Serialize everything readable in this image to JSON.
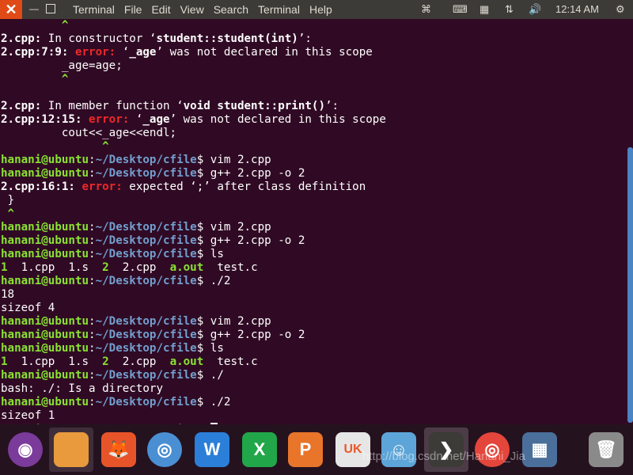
{
  "topbar": {
    "close": "✕",
    "menu": [
      "Terminal",
      "File",
      "Edit",
      "View",
      "Search",
      "Terminal",
      "Help"
    ],
    "clock": "12:14 AM"
  },
  "terminal": {
    "lines": [
      [
        {
          "t": "         ^",
          "c": "g"
        }
      ],
      [
        {
          "t": "2.cpp:",
          "c": "b"
        },
        {
          "t": " In constructor ‘"
        },
        {
          "t": "student::student(int)",
          "c": "b"
        },
        {
          "t": "’:"
        }
      ],
      [
        {
          "t": "2.cpp:7:9:",
          "c": "b"
        },
        {
          "t": " "
        },
        {
          "t": "error:",
          "c": "r"
        },
        {
          "t": " ‘"
        },
        {
          "t": "_age",
          "c": "b"
        },
        {
          "t": "’ was not declared in this scope"
        }
      ],
      [
        {
          "t": "         _age=age;"
        }
      ],
      [
        {
          "t": "         ^",
          "c": "g"
        }
      ],
      [
        {
          "t": ""
        }
      ],
      [
        {
          "t": "2.cpp:",
          "c": "b"
        },
        {
          "t": " In member function ‘"
        },
        {
          "t": "void student::print()",
          "c": "b"
        },
        {
          "t": "’:"
        }
      ],
      [
        {
          "t": "2.cpp:12:15:",
          "c": "b"
        },
        {
          "t": " "
        },
        {
          "t": "error:",
          "c": "r"
        },
        {
          "t": " ‘"
        },
        {
          "t": "_age",
          "c": "b"
        },
        {
          "t": "’ was not declared in this scope"
        }
      ],
      [
        {
          "t": "         cout<<_age<<endl;"
        }
      ],
      [
        {
          "t": "               ^",
          "c": "g"
        }
      ],
      [
        {
          "t": "hanani@ubuntu",
          "c": "g"
        },
        {
          "t": ":"
        },
        {
          "t": "~/Desktop/cfile",
          "c": "bl"
        },
        {
          "t": "$ vim 2.cpp"
        }
      ],
      [
        {
          "t": "hanani@ubuntu",
          "c": "g"
        },
        {
          "t": ":"
        },
        {
          "t": "~/Desktop/cfile",
          "c": "bl"
        },
        {
          "t": "$ g++ 2.cpp -o 2"
        }
      ],
      [
        {
          "t": "2.cpp:16:1:",
          "c": "b"
        },
        {
          "t": " "
        },
        {
          "t": "error:",
          "c": "r"
        },
        {
          "t": " expected ‘;’ after class definition"
        }
      ],
      [
        {
          "t": " }"
        }
      ],
      [
        {
          "t": " ^",
          "c": "g"
        }
      ],
      [
        {
          "t": "hanani@ubuntu",
          "c": "g"
        },
        {
          "t": ":"
        },
        {
          "t": "~/Desktop/cfile",
          "c": "bl"
        },
        {
          "t": "$ vim 2.cpp"
        }
      ],
      [
        {
          "t": "hanani@ubuntu",
          "c": "g"
        },
        {
          "t": ":"
        },
        {
          "t": "~/Desktop/cfile",
          "c": "bl"
        },
        {
          "t": "$ g++ 2.cpp -o 2"
        }
      ],
      [
        {
          "t": "hanani@ubuntu",
          "c": "g"
        },
        {
          "t": ":"
        },
        {
          "t": "~/Desktop/cfile",
          "c": "bl"
        },
        {
          "t": "$ ls"
        }
      ],
      [
        {
          "t": "1",
          "c": "g"
        },
        {
          "t": "  1.cpp  1.s  "
        },
        {
          "t": "2",
          "c": "g"
        },
        {
          "t": "  2.cpp  "
        },
        {
          "t": "a.out",
          "c": "g"
        },
        {
          "t": "  test.c"
        }
      ],
      [
        {
          "t": "hanani@ubuntu",
          "c": "g"
        },
        {
          "t": ":"
        },
        {
          "t": "~/Desktop/cfile",
          "c": "bl"
        },
        {
          "t": "$ ./2"
        }
      ],
      [
        {
          "t": "18"
        }
      ],
      [
        {
          "t": "sizeof 4"
        }
      ],
      [
        {
          "t": "hanani@ubuntu",
          "c": "g"
        },
        {
          "t": ":"
        },
        {
          "t": "~/Desktop/cfile",
          "c": "bl"
        },
        {
          "t": "$ vim 2.cpp"
        }
      ],
      [
        {
          "t": "hanani@ubuntu",
          "c": "g"
        },
        {
          "t": ":"
        },
        {
          "t": "~/Desktop/cfile",
          "c": "bl"
        },
        {
          "t": "$ g++ 2.cpp -o 2"
        }
      ],
      [
        {
          "t": "hanani@ubuntu",
          "c": "g"
        },
        {
          "t": ":"
        },
        {
          "t": "~/Desktop/cfile",
          "c": "bl"
        },
        {
          "t": "$ ls"
        }
      ],
      [
        {
          "t": "1",
          "c": "g"
        },
        {
          "t": "  1.cpp  1.s  "
        },
        {
          "t": "2",
          "c": "g"
        },
        {
          "t": "  2.cpp  "
        },
        {
          "t": "a.out",
          "c": "g"
        },
        {
          "t": "  test.c"
        }
      ],
      [
        {
          "t": "hanani@ubuntu",
          "c": "g"
        },
        {
          "t": ":"
        },
        {
          "t": "~/Desktop/cfile",
          "c": "bl"
        },
        {
          "t": "$ ./"
        }
      ],
      [
        {
          "t": "bash: ./: Is a directory"
        }
      ],
      [
        {
          "t": "hanani@ubuntu",
          "c": "g"
        },
        {
          "t": ":"
        },
        {
          "t": "~/Desktop/cfile",
          "c": "bl"
        },
        {
          "t": "$ ./2"
        }
      ],
      [
        {
          "t": "sizeof 1"
        }
      ],
      [
        {
          "t": "hanani@ubuntu",
          "c": "g"
        },
        {
          "t": ":"
        },
        {
          "t": "~/Desktop/cfile",
          "c": "bl"
        },
        {
          "t": "$ "
        }
      ]
    ]
  },
  "dock": {
    "items": [
      {
        "name": "ubuntu-logo-icon",
        "color": "#7a3b9a",
        "glyph": "◉"
      },
      {
        "name": "files-icon",
        "color": "#e89a3c",
        "glyph": ""
      },
      {
        "name": "firefox-icon",
        "color": "#e8542a",
        "glyph": "🦊"
      },
      {
        "name": "chromium-icon",
        "color": "#4a8fd4",
        "glyph": "◎"
      },
      {
        "name": "wps-writer-icon",
        "color": "#2b7fd8",
        "glyph": "W"
      },
      {
        "name": "wps-spreadsheet-icon",
        "color": "#22a64a",
        "glyph": "X"
      },
      {
        "name": "wps-presentation-icon",
        "color": "#e8752a",
        "glyph": "P"
      },
      {
        "name": "software-center-icon",
        "color": "#e6e6e6",
        "glyph": "UK"
      },
      {
        "name": "qq-icon",
        "color": "#5da5d8",
        "glyph": "☺"
      },
      {
        "name": "terminal-icon",
        "color": "#3c3b37",
        "glyph": "❯"
      },
      {
        "name": "chrome-icon",
        "color": "#e4463b",
        "glyph": "◎"
      },
      {
        "name": "workspace-switcher-icon",
        "color": "#4a6f9a",
        "glyph": "▦"
      },
      {
        "name": "trash-icon",
        "color": "#8a8a8a",
        "glyph": "🗑"
      }
    ],
    "watermark": "http://blog.csdn.net/Hanani_Jia"
  }
}
